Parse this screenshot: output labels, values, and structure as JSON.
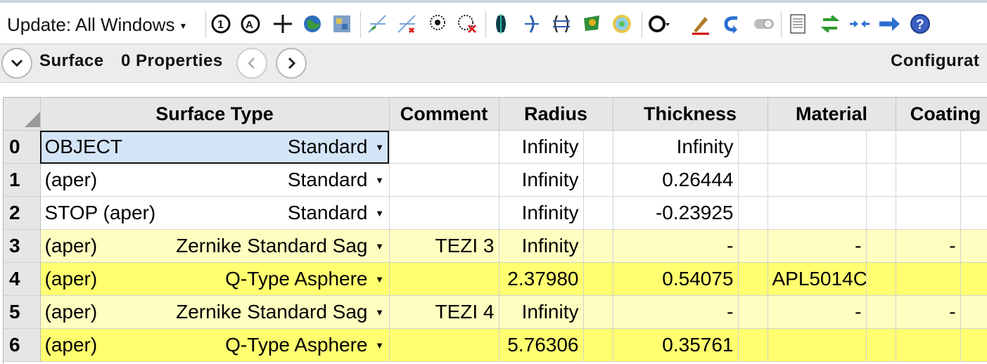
{
  "toolbar": {
    "update_label": "Update: All Windows",
    "icons": [
      "layout-1-icon",
      "layout-a-icon",
      "crosshair-icon",
      "globe-icon",
      "map-icon",
      "ray-fan-icon",
      "ray-fan-x-icon",
      "spot-icon",
      "spot-x-icon",
      "lens-dark-icon",
      "lens-half-icon",
      "lens-outline-icon",
      "footprint-icon",
      "interferogram-icon",
      "circle-icon",
      "pen-tool-icon",
      "undo-arrow-icon",
      "toggle-icon",
      "sheet-icon",
      "swap-icon",
      "merge-icon",
      "forward-arrow-icon",
      "help-icon"
    ]
  },
  "propbar": {
    "surface_label": "Surface",
    "properties_label": "0 Properties",
    "configuration_label": "Configurat"
  },
  "grid": {
    "columns": [
      "Surface Type",
      "Comment",
      "Radius",
      "Thickness",
      "Material",
      "Coating"
    ],
    "rows": [
      {
        "n": "0",
        "name": "OBJECT",
        "type": "Standard",
        "comment": "",
        "radius": "Infinity",
        "thickness": "Infinity",
        "material": "",
        "coating": "",
        "m2": "",
        "c2": "",
        "style": "white"
      },
      {
        "n": "1",
        "name": "(aper)",
        "type": "Standard",
        "comment": "",
        "radius": "Infinity",
        "thickness": "0.26444",
        "material": "",
        "coating": "",
        "m2": "",
        "c2": "",
        "style": "white"
      },
      {
        "n": "2",
        "name": "STOP (aper)",
        "type": "Standard",
        "comment": "",
        "radius": "Infinity",
        "thickness": "-0.23925",
        "material": "",
        "coating": "",
        "m2": "",
        "c2": "",
        "style": "white"
      },
      {
        "n": "3",
        "name": "(aper)",
        "type": "Zernike Standard Sag",
        "comment": "TEZI 3",
        "radius": "Infinity",
        "thickness": "-",
        "material": "-",
        "coating": "-",
        "m2": "",
        "c2": "",
        "style": "light"
      },
      {
        "n": "4",
        "name": "(aper)",
        "type": "Q-Type Asphere",
        "comment": "",
        "radius": "2.37980",
        "thickness": "0.54075",
        "material": "APL5014C",
        "coating": "",
        "m2": "",
        "c2": "",
        "style": "bright"
      },
      {
        "n": "5",
        "name": "(aper)",
        "type": "Zernike Standard Sag",
        "comment": "TEZI 4",
        "radius": "Infinity",
        "thickness": "-",
        "material": "-",
        "coating": "-",
        "m2": "",
        "c2": "",
        "style": "light"
      },
      {
        "n": "6",
        "name": "(aper)",
        "type": "Q-Type Asphere",
        "comment": "",
        "radius": "5.76306",
        "thickness": "0.35761",
        "material": "",
        "coating": "",
        "m2": "",
        "c2": "",
        "style": "bright"
      }
    ]
  },
  "colors": {
    "row_light": "#fefec0",
    "row_bright": "#ffff70",
    "selected": "#d5e5f8"
  }
}
